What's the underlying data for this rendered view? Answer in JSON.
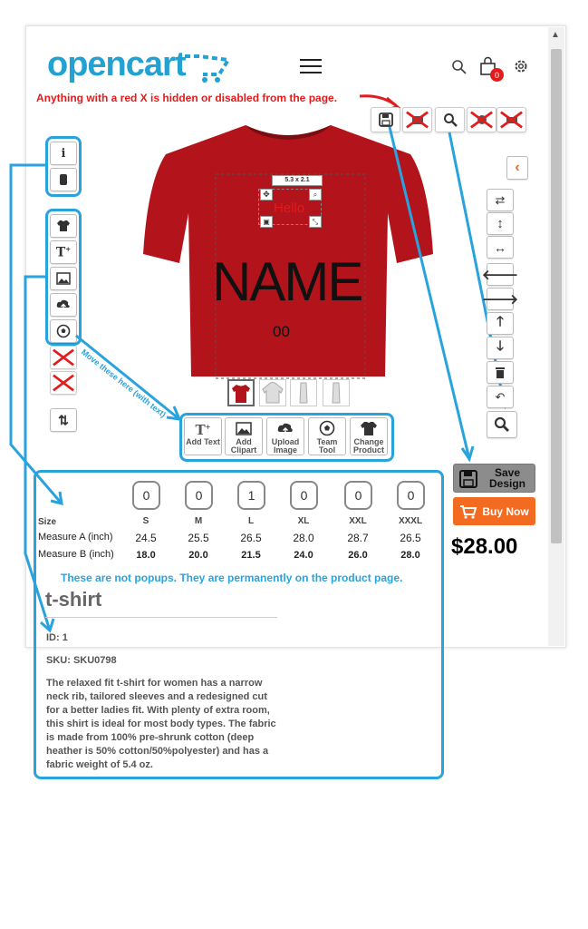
{
  "header": {
    "logo_text": "opencart",
    "cart_count": "0"
  },
  "annotations": {
    "red_note": "Anything with a red X is hidden or disabled from the page.",
    "move_note": "Move these here (with text)",
    "not_popups": "These are not popups. They are permanently on the product page."
  },
  "canvas": {
    "size_label": "5.3 x 2.1",
    "hello_text": "Hello",
    "name_text": "NAME",
    "number_text": "00"
  },
  "tools": [
    {
      "label": "Add Text",
      "icon": "text-icon"
    },
    {
      "label": "Add Clipart",
      "icon": "image-icon"
    },
    {
      "label": "Upload Image",
      "icon": "upload-icon"
    },
    {
      "label": "Team Tool",
      "icon": "ball-icon"
    },
    {
      "label": "Change Product",
      "icon": "tshirt-icon"
    }
  ],
  "sizes": {
    "row_label": "Size",
    "quantities": [
      "0",
      "0",
      "1",
      "0",
      "0",
      "0"
    ],
    "headers": [
      "S",
      "M",
      "L",
      "XL",
      "XXL",
      "XXXL"
    ],
    "measure_a_label": "Measure A (inch)",
    "measure_a": [
      "24.5",
      "25.5",
      "26.5",
      "28.0",
      "28.7",
      "26.5"
    ],
    "measure_b_label": "Measure B (inch)",
    "measure_b": [
      "18.0",
      "20.0",
      "21.5",
      "24.0",
      "26.0",
      "28.0"
    ]
  },
  "product": {
    "title": "t-shirt",
    "id": "ID: 1",
    "sku": "SKU: SKU0798",
    "description": "The relaxed fit t-shirt for women has a narrow neck rib, tailored sleeves and a redesigned cut for a better ladies fit. With plenty of extra room, this shirt is ideal for most body types. The fabric is made from 100% pre-shrunk cotton (deep heather is 50% cotton/50%polyester) and has a fabric weight of 5.4 oz."
  },
  "actions": {
    "save_label_1": "Save",
    "save_label_2": "Design",
    "buy_label": "Buy Now",
    "price": "$28.00"
  },
  "colors": {
    "accent": "#29a3dd",
    "shirt": "#b3141b",
    "red": "#e31b1b",
    "buy": "#f26b21",
    "save": "#8c8c8c"
  }
}
